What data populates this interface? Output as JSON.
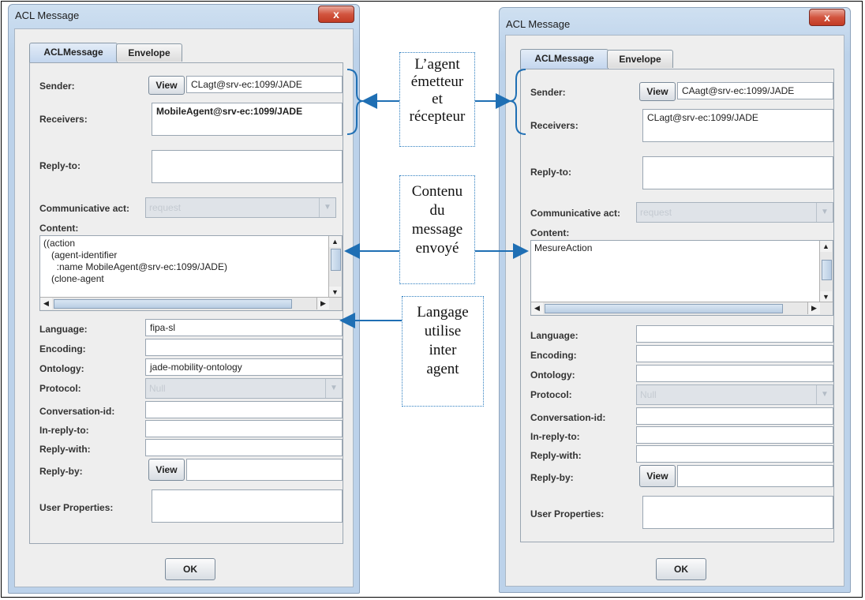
{
  "window_title": "ACL Message",
  "close_glyph": "x",
  "tabs": [
    "ACLMessage",
    "Envelope"
  ],
  "labels": {
    "sender": "Sender:",
    "receivers": "Receivers:",
    "reply_to": "Reply-to:",
    "communicative_act": "Communicative act:",
    "content": "Content:",
    "language": "Language:",
    "encoding": "Encoding:",
    "ontology": "Ontology:",
    "protocol": "Protocol:",
    "conversation_id": "Conversation-id:",
    "in_reply_to": "In-reply-to:",
    "reply_with": "Reply-with:",
    "reply_by": "Reply-by:",
    "user_properties": "User Properties:"
  },
  "view_label": "View",
  "ok_label": "OK",
  "left": {
    "sender": "CLagt@srv-ec:1099/JADE",
    "receivers": "MobileAgent@srv-ec:1099/JADE",
    "reply_to": "",
    "communicative_act": "request",
    "content_lines": [
      "((action",
      "   (agent-identifier",
      "     :name MobileAgent@srv-ec:1099/JADE)",
      "   (clone-agent"
    ],
    "language": "fipa-sl",
    "encoding": "",
    "ontology": "jade-mobility-ontology",
    "protocol": "Null"
  },
  "right": {
    "sender": "CAagt@srv-ec:1099/JADE",
    "receivers": "CLagt@srv-ec:1099/JADE",
    "reply_to": "",
    "communicative_act": "request",
    "content_lines": [
      "MesureAction"
    ],
    "language": "",
    "encoding": "",
    "ontology": "",
    "protocol": "Null"
  },
  "annotations": {
    "agents": [
      "L’agent",
      "émetteur",
      "et",
      "récepteur"
    ],
    "content": [
      "Contenu",
      "du",
      "message",
      "envoyé"
    ],
    "language": [
      "Langage",
      "utilise",
      "inter",
      "agent"
    ]
  },
  "colors": {
    "arrow": "#1f6fb4",
    "close": "#c94a34"
  }
}
